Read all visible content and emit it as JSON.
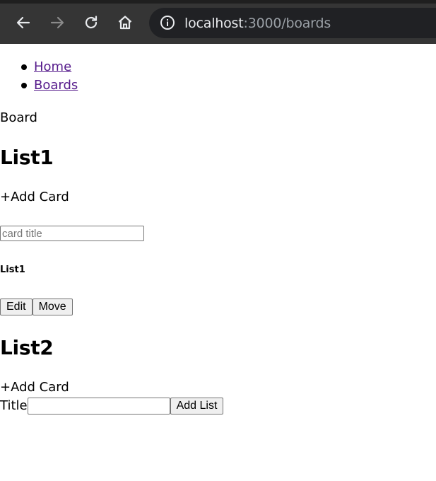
{
  "browser": {
    "url_host": "localhost",
    "url_path": ":3000/boards",
    "back_icon": "arrow-left-icon",
    "forward_icon": "arrow-right-icon",
    "reload_icon": "reload-icon",
    "home_icon": "home-icon",
    "info_icon": "info-icon",
    "forward_enabled": false
  },
  "nav": {
    "items": [
      {
        "label": "Home"
      },
      {
        "label": "Boards"
      }
    ]
  },
  "board": {
    "label": "Board",
    "lists": [
      {
        "title": "List1",
        "add_card_label": "+Add Card",
        "card_input_placeholder": "card title",
        "cards": [
          {
            "title": "List1",
            "edit_label": "Edit",
            "move_label": "Move"
          }
        ]
      },
      {
        "title": "List2",
        "add_card_label": "+Add Card"
      }
    ],
    "new_list": {
      "title_label": "Title",
      "title_value": "",
      "add_list_label": "Add List"
    }
  },
  "colors": {
    "browser_bar": "#353535",
    "address_bar": "#202124",
    "link": "#551a8b",
    "button_bg": "#efefef"
  }
}
